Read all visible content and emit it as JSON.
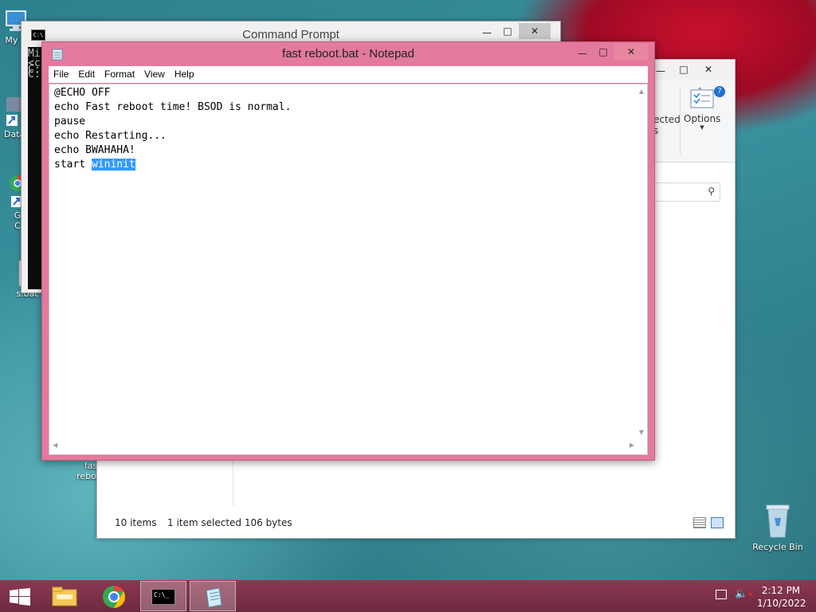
{
  "desktop": {
    "icons": [
      {
        "label": "My C",
        "icon": "computer-icon"
      },
      {
        "label": "Data",
        "icon": "shortcut-icon"
      },
      {
        "label": "G",
        "label2": "C",
        "icon": "chrome-shortcut-icon"
      },
      {
        "label": "s.bat",
        "icon": "bat-file-icon"
      },
      {
        "label": "fas",
        "label2": "reboot",
        "icon": "bat-file-icon"
      },
      {
        "label": "Recycle Bin",
        "icon": "recycle-bin-icon"
      }
    ]
  },
  "cmd_window": {
    "title": "Command Prompt",
    "lines": [
      "Mi",
      "<c",
      "",
      "C:",
      "",
      "C:"
    ]
  },
  "explorer_window": {
    "ribbon_partial_label": "ected",
    "ribbon_partial_label2": "s",
    "options_label": "Options",
    "status_items": "10 items",
    "status_selected": "1 item selected  106 bytes"
  },
  "notepad": {
    "title": "fast reboot.bat - Notepad",
    "menu": [
      "File",
      "Edit",
      "Format",
      "View",
      "Help"
    ],
    "lines": [
      "@ECHO OFF",
      "echo Fast reboot time! BSOD is normal.",
      "pause",
      "echo Restarting...",
      "echo BWAHAHA!"
    ],
    "last_line_prefix": "start ",
    "last_line_selected": "wininit"
  },
  "taskbar": {
    "time": "2:12 PM",
    "date": "1/10/2022",
    "accent": "#7a2f47"
  }
}
